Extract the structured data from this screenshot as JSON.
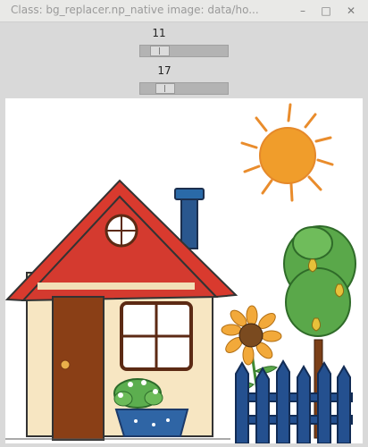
{
  "window": {
    "title": "Class: bg_replacer.np_native image: data/ho...",
    "minimize_icon": "minimize-icon",
    "maximize_icon": "maximize-icon",
    "close_icon": "close-icon"
  },
  "sliders": [
    {
      "value": "11",
      "fraction": 0.11
    },
    {
      "value": "17",
      "fraction": 0.17
    }
  ],
  "image": {
    "subject": "drawing-of-house-sun-tree-sunflower-fence"
  }
}
